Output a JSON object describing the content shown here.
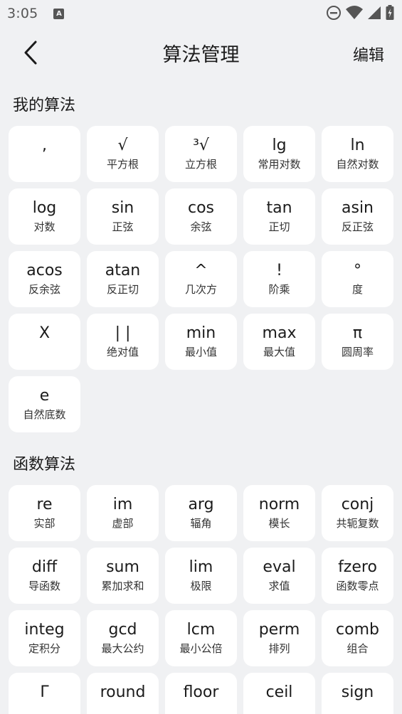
{
  "status": {
    "time": "3:05",
    "a_label": "A"
  },
  "header": {
    "title": "算法管理",
    "edit_label": "编辑"
  },
  "sections": [
    {
      "title": "我的算法",
      "items": [
        {
          "sym": ",",
          "desc": ""
        },
        {
          "sym": "√",
          "desc": "平方根"
        },
        {
          "sym": "³√",
          "desc": "立方根"
        },
        {
          "sym": "lg",
          "desc": "常用对数"
        },
        {
          "sym": "ln",
          "desc": "自然对数"
        },
        {
          "sym": "log",
          "desc": "对数"
        },
        {
          "sym": "sin",
          "desc": "正弦"
        },
        {
          "sym": "cos",
          "desc": "余弦"
        },
        {
          "sym": "tan",
          "desc": "正切"
        },
        {
          "sym": "asin",
          "desc": "反正弦"
        },
        {
          "sym": "acos",
          "desc": "反余弦"
        },
        {
          "sym": "atan",
          "desc": "反正切"
        },
        {
          "sym": "^",
          "desc": "几次方"
        },
        {
          "sym": "!",
          "desc": "阶乘"
        },
        {
          "sym": "°",
          "desc": "度"
        },
        {
          "sym": "X",
          "desc": ""
        },
        {
          "sym": "| |",
          "desc": "绝对值"
        },
        {
          "sym": "min",
          "desc": "最小值"
        },
        {
          "sym": "max",
          "desc": "最大值"
        },
        {
          "sym": "π",
          "desc": "圆周率"
        },
        {
          "sym": "e",
          "desc": "自然底数"
        }
      ]
    },
    {
      "title": "函数算法",
      "items": [
        {
          "sym": "re",
          "desc": "实部"
        },
        {
          "sym": "im",
          "desc": "虚部"
        },
        {
          "sym": "arg",
          "desc": "辐角"
        },
        {
          "sym": "norm",
          "desc": "模长"
        },
        {
          "sym": "conj",
          "desc": "共轭复数"
        },
        {
          "sym": "diff",
          "desc": "导函数"
        },
        {
          "sym": "sum",
          "desc": "累加求和"
        },
        {
          "sym": "lim",
          "desc": "极限"
        },
        {
          "sym": "eval",
          "desc": "求值"
        },
        {
          "sym": "fzero",
          "desc": "函数零点"
        },
        {
          "sym": "integ",
          "desc": "定积分"
        },
        {
          "sym": "gcd",
          "desc": "最大公约"
        },
        {
          "sym": "lcm",
          "desc": "最小公倍"
        },
        {
          "sym": "perm",
          "desc": "排列"
        },
        {
          "sym": "comb",
          "desc": "组合"
        },
        {
          "sym": "Γ",
          "desc": ""
        },
        {
          "sym": "round",
          "desc": ""
        },
        {
          "sym": "floor",
          "desc": ""
        },
        {
          "sym": "ceil",
          "desc": ""
        },
        {
          "sym": "sign",
          "desc": ""
        }
      ]
    }
  ]
}
